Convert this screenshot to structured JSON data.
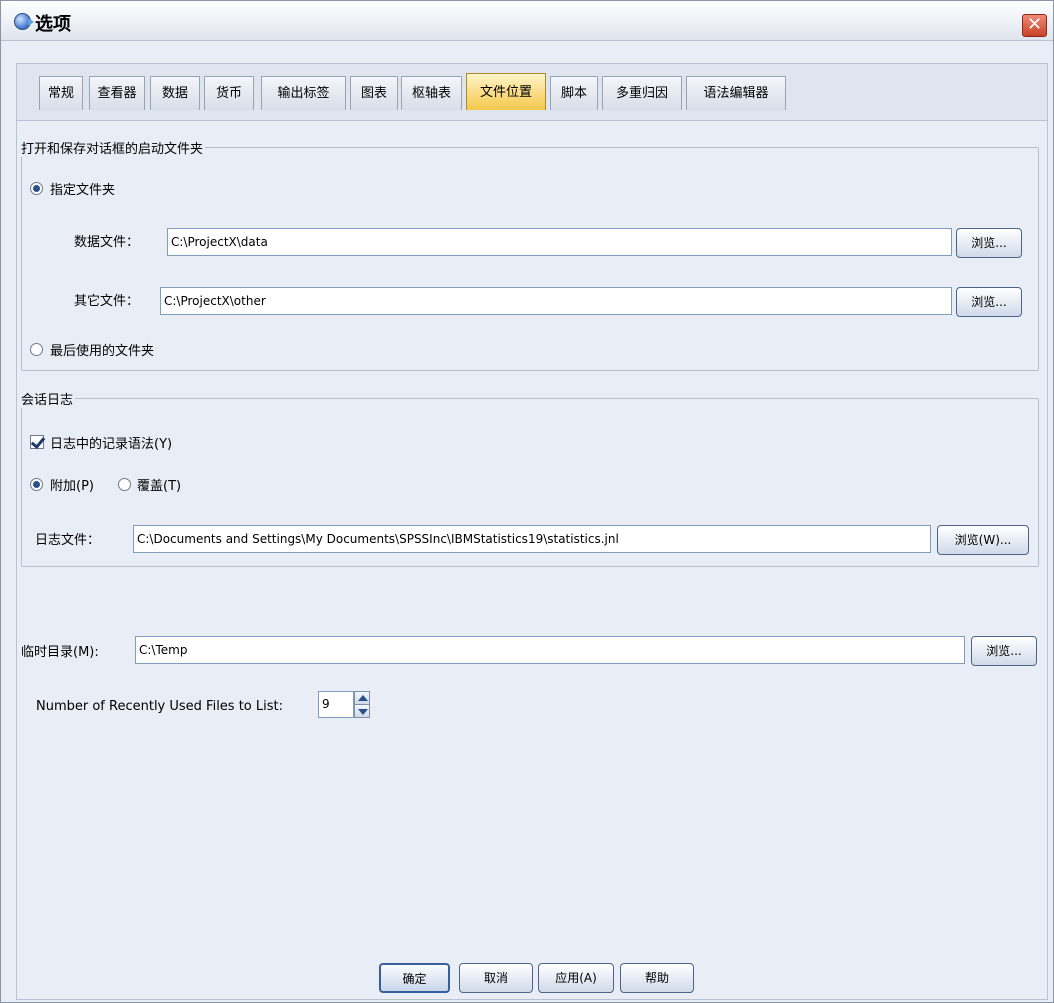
{
  "window": {
    "title": "选项"
  },
  "tabs": [
    {
      "label": "常规"
    },
    {
      "label": "查看器"
    },
    {
      "label": "数据"
    },
    {
      "label": "货币"
    },
    {
      "label": "输出标签"
    },
    {
      "label": "图表"
    },
    {
      "label": "枢轴表"
    },
    {
      "label": "文件位置"
    },
    {
      "label": "脚本"
    },
    {
      "label": "多重归因"
    },
    {
      "label": "语法编辑器"
    }
  ],
  "active_tab": "文件位置",
  "startup_folders": {
    "title": "打开和保存对话框的启动文件夹",
    "specified_label": "指定文件夹",
    "data_files_label": "数据文件：",
    "data_files_value": "C:\\ProjectX\\data",
    "other_files_label": "其它文件：",
    "other_files_value": "C:\\ProjectX\\other",
    "browse_label": "浏览...",
    "last_used_label": "最后使用的文件夹"
  },
  "session_journal": {
    "title": "会话日志",
    "record_label": "日志中的记录语法(Y)",
    "append_label": "附加(P)",
    "overwrite_label": "覆盖(T)",
    "journal_file_label": "日志文件：",
    "journal_file_value": "C:\\Documents and Settings\\My Documents\\SPSSInc\\IBMStatistics19\\statistics.jnl",
    "browse_label": "浏览(W)..."
  },
  "temp_dir": {
    "label": "临时目录(M):",
    "value": "C:\\Temp",
    "browse_label": "浏览..."
  },
  "recent_files": {
    "label": "Number of Recently Used Files to List:",
    "value": "9"
  },
  "footer": {
    "ok": "确定",
    "cancel": "取消",
    "apply": "应用(A)",
    "help": "帮助"
  }
}
